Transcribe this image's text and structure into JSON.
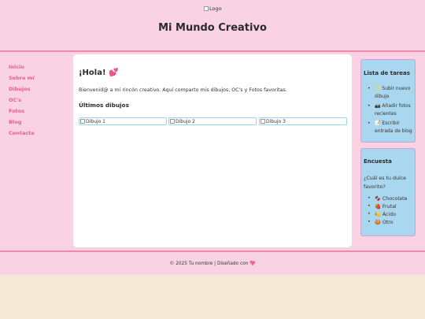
{
  "header": {
    "logo_alt": "Logo",
    "title": "Mi Mundo Creativo"
  },
  "nav": {
    "items": [
      "Inicio",
      "Sobre mí",
      "Dibujos",
      "OC's",
      "Fotos",
      "Blog",
      "Contacto"
    ]
  },
  "main": {
    "greeting": "¡Hola!",
    "greeting_emoji": "💕",
    "intro": "Bienvenid@ a mi rincón creativo. Aquí comparto mis dibujos, OC's y Fotos favoritas.",
    "section_title": "Últimos dibujos",
    "gallery": [
      "Dibujo 1",
      "Dibujo 2",
      "Dibujo 3"
    ]
  },
  "tasks": {
    "title": "Lista de tareas",
    "items": [
      {
        "icon": "✨",
        "text": "Subir nuevo dibujo"
      },
      {
        "icon": "📷",
        "text": "Añadir fotos recientes"
      },
      {
        "icon": "📝",
        "text": "Escribir entrada de blog"
      }
    ]
  },
  "poll": {
    "title": "Encuesta",
    "question": "¿Cuál es tu dulce favorito?",
    "options": [
      {
        "icon": "🍫",
        "text": "Chocolate"
      },
      {
        "icon": "🍓",
        "text": "Frutal"
      },
      {
        "icon": "🍋",
        "text": "Ácido"
      },
      {
        "icon": "🍪",
        "text": "Otro"
      }
    ]
  },
  "footer": {
    "text": "© 2025 Tu nombre | Diseñado con",
    "heart": "💖"
  },
  "colors": {
    "pink_bg": "#f9d3e4",
    "pink_border": "#ee8aa6",
    "nav_pink": "#ef5a8f",
    "widget_blue": "#a9d7f0",
    "cream_bg": "#f7e9d7"
  }
}
